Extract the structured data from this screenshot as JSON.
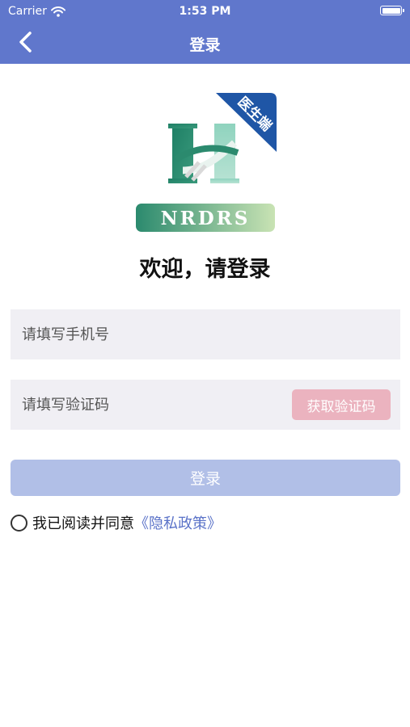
{
  "status_bar": {
    "carrier": "Carrier",
    "time": "1:53 PM"
  },
  "nav": {
    "title": "登录",
    "back_icon": "chevron-left-icon"
  },
  "logo": {
    "brand": "NRDRS",
    "badge": "医生端",
    "letter": "H"
  },
  "welcome": "欢迎，请登录",
  "phone_field": {
    "placeholder": "请填写手机号",
    "value": ""
  },
  "code_field": {
    "placeholder": "请填写验证码",
    "value": ""
  },
  "get_code_button": "获取验证码",
  "login_button": "登录",
  "agreement": {
    "text": "我已阅读并同意",
    "link": "《隐私政策》",
    "checked": false
  },
  "colors": {
    "header": "#6077cc",
    "login_button": "#b1bfe7",
    "code_button": "#ebb3bf",
    "link": "#5a72c8",
    "field_bg": "#f0eff4"
  }
}
